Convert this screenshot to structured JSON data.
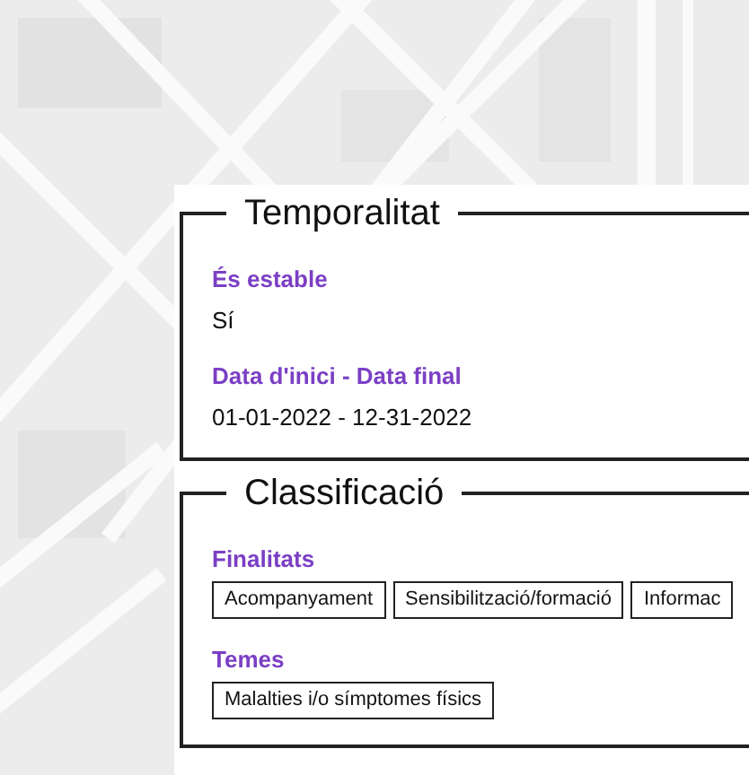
{
  "sections": [
    {
      "title": "Temporalitat",
      "fields": [
        {
          "kind": "text",
          "label": "És estable",
          "value": "Sí"
        },
        {
          "kind": "text",
          "label": "Data d'inici - Data final",
          "value": "01-01-2022 - 12-31-2022"
        }
      ]
    },
    {
      "title": "Classificació",
      "fields": [
        {
          "kind": "tags",
          "label": "Finalitats",
          "tags": [
            "Acompanyament",
            "Sensibilització/formació",
            "Informac"
          ]
        },
        {
          "kind": "tags",
          "label": "Temes",
          "tags": [
            "Malalties i/o símptomes físics"
          ]
        }
      ]
    }
  ]
}
